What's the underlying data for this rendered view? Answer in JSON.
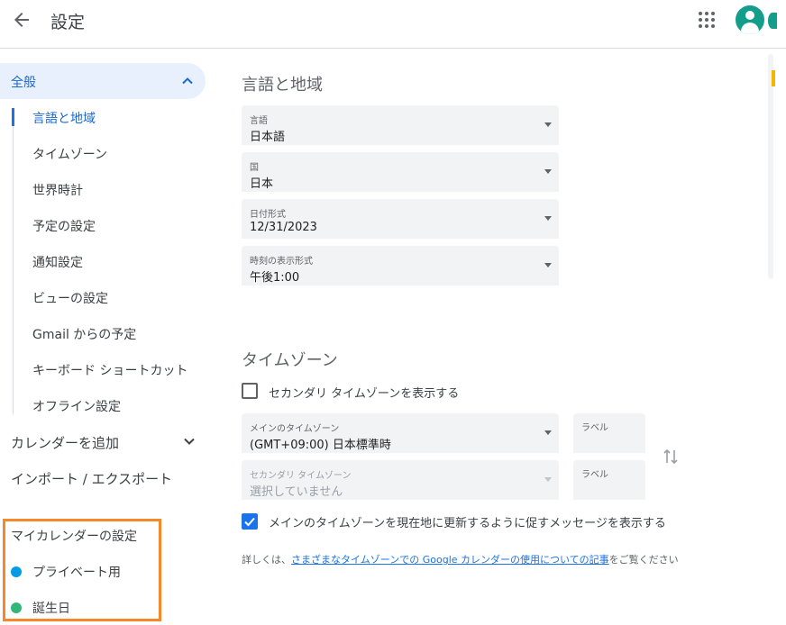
{
  "header": {
    "title": "設定"
  },
  "sidebar": {
    "general_label": "全般",
    "sub_items": [
      "言語と地域",
      "タイムゾーン",
      "世界時計",
      "予定の設定",
      "通知設定",
      "ビューの設定",
      "Gmail からの予定",
      "キーボード ショートカット",
      "オフライン設定"
    ],
    "add_calendar": "カレンダーを追加",
    "import_export": "インポート / エクスポート",
    "my_calendars_title": "マイカレンダーの設定",
    "my_calendars": [
      {
        "name": "プライベート用",
        "color": "#039be5"
      },
      {
        "name": "誕生日",
        "color": "#33b679"
      }
    ]
  },
  "language_region": {
    "title": "言語と地域",
    "language": {
      "caption": "言語",
      "value": "日本語"
    },
    "country": {
      "caption": "国",
      "value": "日本"
    },
    "date_format": {
      "caption": "日付形式",
      "value": "12/31/2023"
    },
    "time_format": {
      "caption": "時刻の表示形式",
      "value": "午後1:00"
    }
  },
  "timezone": {
    "title": "タイムゾーン",
    "show_secondary_label": "セカンダリ タイムゾーンを表示する",
    "primary": {
      "caption": "メインのタイムゾーン",
      "value": "(GMT+09:00) 日本標準時"
    },
    "secondary": {
      "caption": "セカンダリ タイムゾーン",
      "value": "選択していません"
    },
    "label_caption": "ラベル",
    "update_prompt_label": "メインのタイムゾーンを現在地に更新するように促すメッセージを表示する",
    "help_prefix": "詳しくは、",
    "help_link": "さまざまなタイムゾーンでの Google カレンダーの使用についての記事",
    "help_suffix": "をご覧ください"
  },
  "colors": {
    "accent": "#1a73e8",
    "highlight": "#f6882a"
  }
}
